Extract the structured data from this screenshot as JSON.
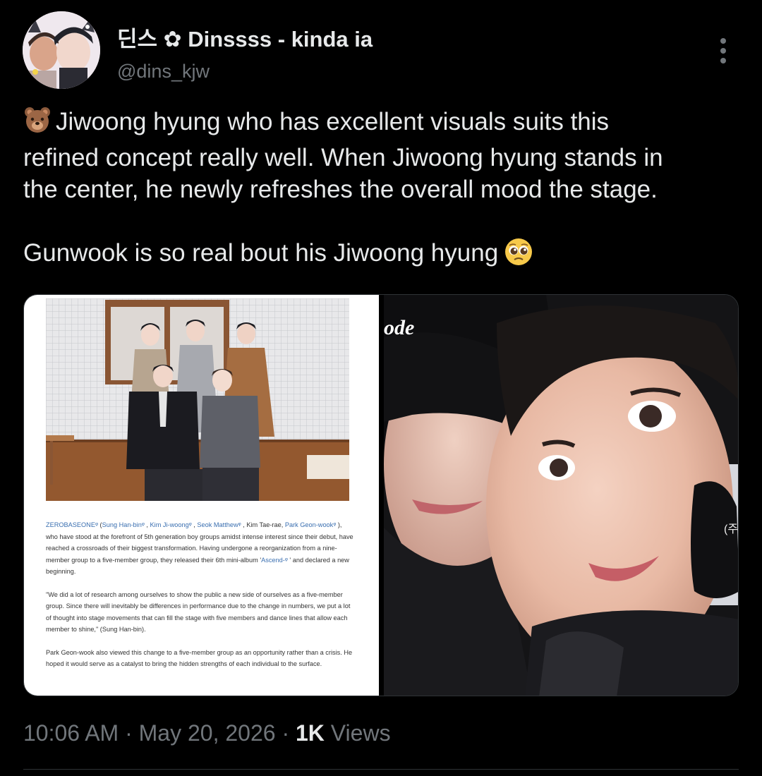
{
  "tweet": {
    "display_name": "딘스 ✿ Dinssss - kinda ia",
    "handle": "@dins_kjw",
    "paragraph1": [
      "Jiwoong hyung who has excellent visuals suits this",
      "refined concept really well. When Jiwoong hyung stands in",
      "the center, he newly refreshes the overall mood the stage."
    ],
    "paragraph2": "Gunwook is so real bout his Jiwoong hyung",
    "timestamp": "10:06 AM",
    "date": "May 20, 2026",
    "views_count": "1K",
    "views_label": "Views"
  },
  "article": {
    "p1": {
      "group": "ZEROBASEONE",
      "hanbin": "Sung Han-bin",
      "jiwoong": "Kim Ji-woong",
      "matthew": "Seok Matthew",
      "taerae": ", Kim Tae-rae,",
      "gunwook": "Park Geon-wook",
      "text1": "), who have stood at the forefront of 5th generation boy groups amidst intense interest since their debut, have reached a crossroads of their biggest transformation. Having undergone a reorganization from a nine-member group to a five-member group, they released their 6th mini-album '",
      "album": "Ascend-",
      "text2": "' and declared a new beginning."
    },
    "p2": "\"We did a lot of research among ourselves to show the public a new side of ourselves as a five-member group. Since there will inevitably be differences in performance due to the change in numbers, we put a lot of thought into stage movements that can fill the stage with five members and dance lines that allow each member to shine,\" (Sung Han-bin).",
    "p3": "Park Geon-wook also viewed this change to a five-member group as an opportunity rather than a crisis. He hoped it would serve as a catalyst to bring the hidden strengths of each individual to the surface."
  },
  "photo_watermark": "ode",
  "photo_corner_mark": "(주",
  "icons": {
    "emoji_start": "bear-face-emoji",
    "emoji_end": "pleading-face-emoji",
    "more": "more-options-icon"
  }
}
